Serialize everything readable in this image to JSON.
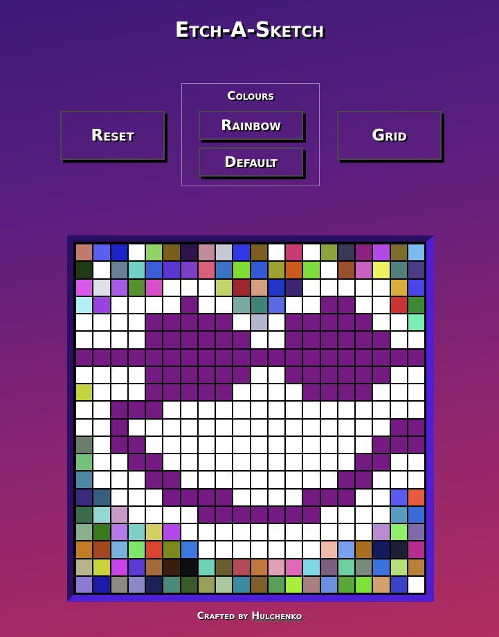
{
  "title": "Etch-A-Sketch",
  "buttons": {
    "reset": "Reset",
    "grid": "Grid",
    "rainbow": "Rainbow",
    "default": "Default"
  },
  "colours_label": "Colours",
  "footer": {
    "prefix": "Crafted by ",
    "author": "Hulchenko"
  },
  "board": {
    "size": 20,
    "cells": [
      [
        "#c17a6c",
        "#5a5ff0",
        "#1c22c9",
        "#ffffff",
        "#8fd464",
        "#7a5c1b",
        "#2b154a",
        "#c48c99",
        "#c7c7d3",
        "#3138e8",
        "#7d5e22",
        "#ffffff",
        "#cc3a73",
        "#ffffff",
        "#8ea33e",
        "#3a3a55",
        "#8a2283",
        "#b14ae8",
        "#7e6e2d",
        "#7bbcf0"
      ],
      [
        "#1d3a15",
        "#ffffff",
        "#6a7f96",
        "#6fd2c4",
        "#3b5ed8",
        "#5b36d2",
        "#7d3fc8",
        "#d9607a",
        "#3a73c3",
        "#7fdc32",
        "#3359d6",
        "#9ea130",
        "#cc5a1e",
        "#7fdb3d",
        "#ffffff",
        "#9b4f2d",
        "#c961c1",
        "#eef262",
        "#4f807b",
        "#4d3d87"
      ],
      [
        "#d95ae8",
        "#e0e0e6",
        "#a75ae3",
        "#5a8f31",
        "#d94fc6",
        "#ffffff",
        "#ffffff",
        "#ffffff",
        "#c2d36a",
        "#a0262d",
        "#d59f7e",
        "#1f36c7",
        "#3e2474",
        "#ffffff",
        "#ffffff",
        "#ffffff",
        "#ffffff",
        "#ffffff",
        "#dbae3a",
        "#4a44ea"
      ],
      [
        "#b1eff5",
        "#9a42e0",
        "#ffffff",
        "#ffffff",
        "#ffffff",
        "#ffffff",
        "#751a83",
        "#ffffff",
        "#ffffff",
        "#78aa9f",
        "#3e8479",
        "#5a6ae3",
        "#ffffff",
        "#ffffff",
        "#751a83",
        "#751a83",
        "#ffffff",
        "#ffffff",
        "#ca3234",
        "#3d8a33"
      ],
      [
        "#ffffff",
        "#ffffff",
        "#ffffff",
        "#ffffff",
        "#751a83",
        "#751a83",
        "#751a83",
        "#751a83",
        "#751a83",
        "#ffffff",
        "#b4b6d0",
        "#ffffff",
        "#751a83",
        "#751a83",
        "#751a83",
        "#751a83",
        "#751a83",
        "#ffffff",
        "#ffffff",
        "#78efb0"
      ],
      [
        "#ffffff",
        "#ffffff",
        "#ffffff",
        "#ffffff",
        "#751a83",
        "#751a83",
        "#751a83",
        "#751a83",
        "#751a83",
        "#751a83",
        "#ffffff",
        "#ffffff",
        "#751a83",
        "#751a83",
        "#751a83",
        "#751a83",
        "#751a83",
        "#751a83",
        "#ffffff",
        "#ffffff"
      ],
      [
        "#751a83",
        "#751a83",
        "#751a83",
        "#751a83",
        "#751a83",
        "#751a83",
        "#751a83",
        "#751a83",
        "#751a83",
        "#751a83",
        "#751a83",
        "#751a83",
        "#751a83",
        "#751a83",
        "#751a83",
        "#751a83",
        "#751a83",
        "#751a83",
        "#751a83",
        "#751a83"
      ],
      [
        "#ffffff",
        "#ffffff",
        "#ffffff",
        "#ffffff",
        "#751a83",
        "#751a83",
        "#751a83",
        "#751a83",
        "#751a83",
        "#751a83",
        "#ffffff",
        "#ffffff",
        "#751a83",
        "#751a83",
        "#751a83",
        "#751a83",
        "#751a83",
        "#751a83",
        "#ffffff",
        "#ffffff"
      ],
      [
        "#c3d440",
        "#ffffff",
        "#ffffff",
        "#ffffff",
        "#751a83",
        "#751a83",
        "#751a83",
        "#751a83",
        "#751a83",
        "#ffffff",
        "#ffffff",
        "#ffffff",
        "#ffffff",
        "#751a83",
        "#751a83",
        "#751a83",
        "#751a83",
        "#ffffff",
        "#ffffff",
        "#ffffff"
      ],
      [
        "#ffffff",
        "#ffffff",
        "#751a83",
        "#751a83",
        "#751a83",
        "#ffffff",
        "#ffffff",
        "#ffffff",
        "#ffffff",
        "#ffffff",
        "#ffffff",
        "#ffffff",
        "#ffffff",
        "#ffffff",
        "#ffffff",
        "#ffffff",
        "#ffffff",
        "#ffffff",
        "#ffffff",
        "#ffffff"
      ],
      [
        "#ffffff",
        "#ffffff",
        "#751a83",
        "#ffffff",
        "#ffffff",
        "#ffffff",
        "#ffffff",
        "#ffffff",
        "#ffffff",
        "#ffffff",
        "#ffffff",
        "#ffffff",
        "#ffffff",
        "#ffffff",
        "#ffffff",
        "#ffffff",
        "#ffffff",
        "#ffffff",
        "#751a83",
        "#751a83"
      ],
      [
        "#6a7f6a",
        "#ffffff",
        "#751a83",
        "#751a83",
        "#ffffff",
        "#ffffff",
        "#ffffff",
        "#ffffff",
        "#ffffff",
        "#ffffff",
        "#ffffff",
        "#ffffff",
        "#ffffff",
        "#ffffff",
        "#ffffff",
        "#ffffff",
        "#ffffff",
        "#751a83",
        "#751a83",
        "#751a83"
      ],
      [
        "#74c27a",
        "#ffffff",
        "#ffffff",
        "#751a83",
        "#751a83",
        "#ffffff",
        "#ffffff",
        "#ffffff",
        "#ffffff",
        "#ffffff",
        "#ffffff",
        "#ffffff",
        "#ffffff",
        "#ffffff",
        "#ffffff",
        "#ffffff",
        "#751a83",
        "#751a83",
        "#ffffff",
        "#ffffff"
      ],
      [
        "#4a88a3",
        "#ffffff",
        "#ffffff",
        "#ffffff",
        "#751a83",
        "#751a83",
        "#ffffff",
        "#ffffff",
        "#ffffff",
        "#ffffff",
        "#ffffff",
        "#ffffff",
        "#ffffff",
        "#ffffff",
        "#ffffff",
        "#751a83",
        "#751a83",
        "#ffffff",
        "#ffffff",
        "#ffffff"
      ],
      [
        "#3b2a7e",
        "#365f7e",
        "#ffffff",
        "#ffffff",
        "#ffffff",
        "#751a83",
        "#751a83",
        "#751a83",
        "#751a83",
        "#ffffff",
        "#ffffff",
        "#ffffff",
        "#ffffff",
        "#751a83",
        "#751a83",
        "#751a83",
        "#ffffff",
        "#ffffff",
        "#5a5cf0",
        "#e85a3d"
      ],
      [
        "#3a6b4a",
        "#93d8cf",
        "#c79ac8",
        "#ffffff",
        "#ffffff",
        "#ffffff",
        "#ffffff",
        "#751a83",
        "#751a83",
        "#751a83",
        "#751a83",
        "#751a83",
        "#751a83",
        "#751a83",
        "#ffffff",
        "#ffffff",
        "#ffffff",
        "#ffffff",
        "#5a9cbf",
        "#3b6bd8"
      ],
      [
        "#8aad8a",
        "#3a7a1e",
        "#b47ae8",
        "#7ed0c4",
        "#d4cf62",
        "#b14ae8",
        "#ffffff",
        "#ffffff",
        "#ffffff",
        "#ffffff",
        "#ffffff",
        "#ffffff",
        "#ffffff",
        "#ffffff",
        "#ffffff",
        "#ffffff",
        "#ffffff",
        "#b88bd2",
        "#8ef06a",
        "#7e6aab"
      ],
      [
        "#c27c25",
        "#a5471e",
        "#7bb1e0",
        "#7ee66a",
        "#d9452e",
        "#7a8b1e",
        "#3b78e0",
        "#ffffff",
        "#ffffff",
        "#ffffff",
        "#ffffff",
        "#ffffff",
        "#ffffff",
        "#ffffff",
        "#f0b9a8",
        "#7aa0f0",
        "#a96e1e",
        "#151a5e",
        "#1e1e35",
        "#b52e8f"
      ],
      [
        "#b8b48a",
        "#c9d43a",
        "#c944e8",
        "#5a3ad2",
        "#a56a3a",
        "#3a1e0e",
        "#0e0e12",
        "#6ed2b8",
        "#6a5e2e",
        "#b24a5a",
        "#c2773e",
        "#e0a0b8",
        "#e06ab8",
        "#7ed8e8",
        "#7e5e7e",
        "#6ed0a0",
        "#7a8a7a",
        "#3a72e0",
        "#b6e07a",
        "#b8823a"
      ],
      [
        "#8c7ad2",
        "#1e1aa8",
        "#8a8a7e",
        "#8a8ac8",
        "#1a2258",
        "#4a8a7a",
        "#3a5a2a",
        "#9aa05a",
        "#a8c8a0",
        "#3a8aa0",
        "#7e5e2a",
        "#5aa05a",
        "#a8f03a",
        "#a88080",
        "#6a90e0",
        "#5aa83a",
        "#7ee03a",
        "#d2a06a",
        "#3a42c8",
        "#ffffff"
      ]
    ]
  }
}
